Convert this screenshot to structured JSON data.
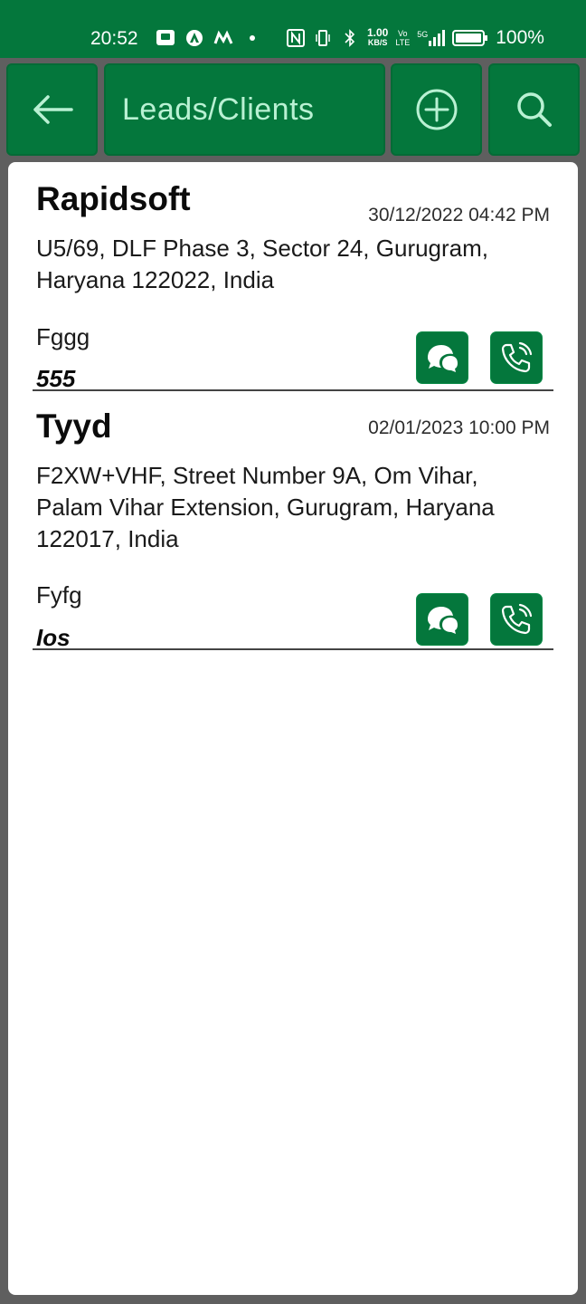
{
  "status_bar": {
    "time": "20:52",
    "net_speed_value": "1.00",
    "net_speed_unit": "KB/S",
    "volte_top": "Vo",
    "volte_bottom": "LTE",
    "signal_label": "5G",
    "battery": "100%"
  },
  "toolbar": {
    "title": "Leads/Clients",
    "back_icon": "arrow-left-icon",
    "add_icon": "plus-circle-icon",
    "search_icon": "search-icon"
  },
  "leads": [
    {
      "name": "Rapidsoft",
      "date": "30/12/2022 04:42 PM",
      "address": "U5/69, DLF Phase 3, Sector 24, Gurugram, Haryana 122022, India",
      "note": "Fggg",
      "phone": "555",
      "chat_icon": "chat-bubbles-icon",
      "call_icon": "phone-call-icon"
    },
    {
      "name": "Tyyd",
      "date": "02/01/2023 10:00 PM",
      "address": "F2XW+VHF, Street Number 9A, Om Vihar, Palam Vihar Extension, Gurugram, Haryana 122017, India",
      "note": "Fyfg",
      "phone": "Ios",
      "chat_icon": "chat-bubbles-icon",
      "call_icon": "phone-call-icon"
    }
  ],
  "colors": {
    "brand_green": "#04773c",
    "title_text": "#b9f1d3"
  }
}
